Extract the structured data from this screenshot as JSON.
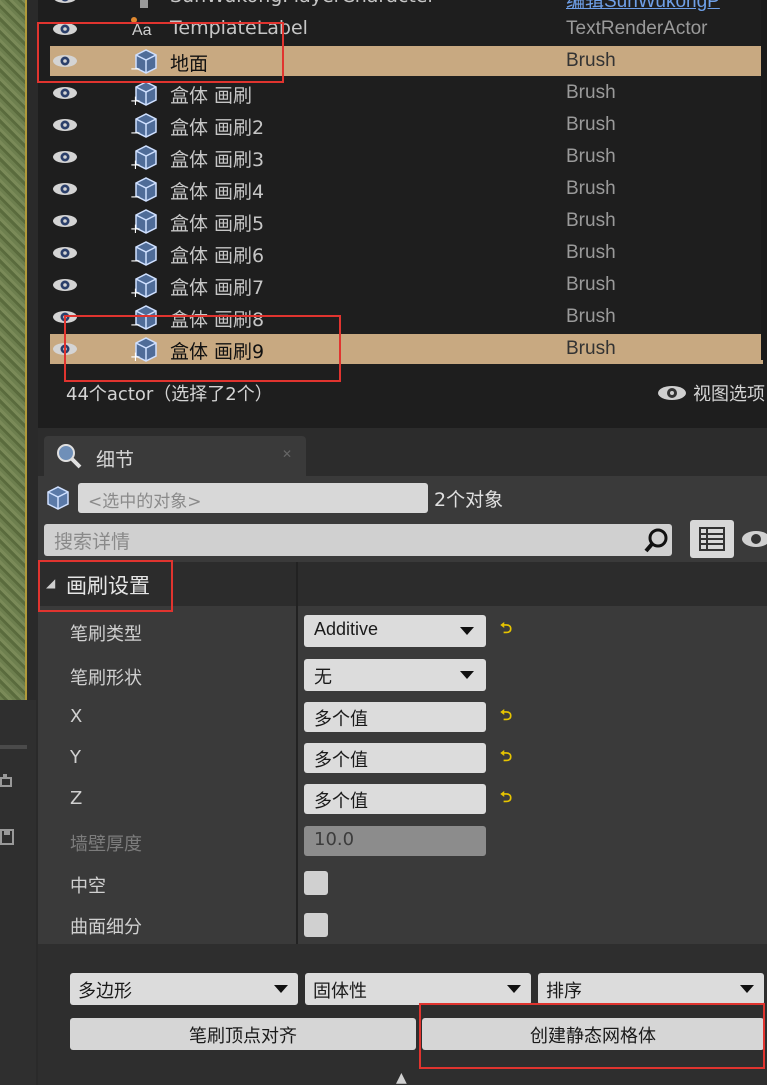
{
  "outliner": {
    "rows": [
      {
        "name": "SunWukongPlayerCharacter",
        "type": "编辑SunWukongP",
        "selected": false,
        "icon": "character-icon",
        "partial": true
      },
      {
        "name": "TemplateLabel",
        "type": "TextRenderActor",
        "selected": false,
        "icon": "text-render-icon"
      },
      {
        "name": "地面",
        "type": "Brush",
        "selected": true,
        "icon": "brush-cube-icon"
      },
      {
        "name": "盒体 画刷",
        "type": "Brush",
        "selected": false,
        "icon": "brush-cube-icon"
      },
      {
        "name": "盒体 画刷2",
        "type": "Brush",
        "selected": false,
        "icon": "brush-cube-icon"
      },
      {
        "name": "盒体 画刷3",
        "type": "Brush",
        "selected": false,
        "icon": "brush-cube-icon"
      },
      {
        "name": "盒体 画刷4",
        "type": "Brush",
        "selected": false,
        "icon": "brush-cube-icon"
      },
      {
        "name": "盒体 画刷5",
        "type": "Brush",
        "selected": false,
        "icon": "brush-cube-icon"
      },
      {
        "name": "盒体 画刷6",
        "type": "Brush",
        "selected": false,
        "icon": "brush-cube-icon"
      },
      {
        "name": "盒体 画刷7",
        "type": "Brush",
        "selected": false,
        "icon": "brush-cube-icon"
      },
      {
        "name": "盒体 画刷8",
        "type": "Brush",
        "selected": false,
        "icon": "brush-cube-icon"
      },
      {
        "name": "盒体 画刷9",
        "type": "Brush",
        "selected": true,
        "icon": "brush-cube-icon"
      }
    ],
    "status": "44个actor（选择了2个）",
    "view_options": "视图选项"
  },
  "details": {
    "tab_label": "细节",
    "selected_placeholder": "<选中的对象>",
    "object_count": "2个对象",
    "search_placeholder": "搜索详情",
    "section_title": "画刷设置",
    "props": {
      "brush_type_label": "笔刷类型",
      "brush_type_value": "Additive",
      "brush_shape_label": "笔刷形状",
      "brush_shape_value": "无",
      "x_label": "X",
      "x_value": "多个值",
      "y_label": "Y",
      "y_value": "多个值",
      "z_label": "Z",
      "z_value": "多个值",
      "wall_thickness_label": "墙壁厚度",
      "wall_thickness_value": "10.0",
      "hollow_label": "中空",
      "tessellated_label": "曲面细分"
    },
    "bottom": {
      "polygons": "多边形",
      "solidity": "固体性",
      "order": "排序",
      "align_vertices": "笔刷顶点对齐",
      "create_static_mesh": "创建静态网格体"
    }
  },
  "colors": {
    "selection": "#c8a981",
    "highlight": "#e0342f",
    "reset_arrow": "#e6c400"
  }
}
